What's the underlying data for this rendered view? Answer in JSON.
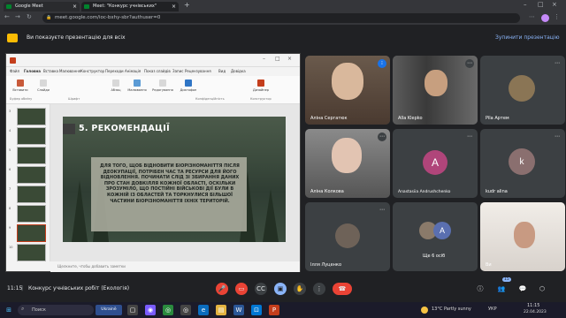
{
  "browser": {
    "tabs": [
      {
        "title": "Google Meet",
        "active": false
      },
      {
        "title": "Meet: \"Конкурс учнівських\"",
        "active": true
      }
    ],
    "url": "meet.google.com/ioc-bxhy-sbr?authuser=0"
  },
  "banner": {
    "message": "Ви показуєте презентацію для всіх",
    "stop_label": "Зупинити презентацію"
  },
  "ppt": {
    "ribbon_tabs": [
      "Файл",
      "Головна",
      "Вставка",
      "Малювання",
      "Конструктор",
      "Переходи",
      "Анімація",
      "Показ слайдів",
      "Запис",
      "Рецензування",
      "Вид",
      "Довідка"
    ],
    "ribbon_buttons": [
      "Вставити",
      "Слайди",
      "Абзац",
      "Малювання",
      "Редагування",
      "Диктофон",
      "Дизайнер"
    ],
    "ribbon_groups": [
      "Буфер обміну",
      "Шрифт",
      "Конфіденційність",
      "Конструктор"
    ],
    "slide_numbers": [
      "3",
      "4",
      "5",
      "6",
      "7",
      "8",
      "9",
      "10"
    ],
    "slide_title": "5. РЕКОМЕНДАЦІЇ",
    "slide_body": "ДЛЯ ТОГО, ЩОБ ВІДНОВИТИ БІОРІЗНОМАНІТТЯ ПІСЛЯ ДЕОКУПАЦІЇ, ПОТРІБЕН ЧАС ТА РЕСУРСИ ДЛЯ ЙОГО ВІДНОВЛЕННЯ. ПОЧИНАТИ СЛІД ЗІ ЗБИРАННЯ ДАНИХ ПРО СТАН ДОВКІЛЛЯ КОЖНОЇ ОБЛАСТІ, ОСКІЛЬКИ ЗРОЗУМІЛО, ЩО ПОСТІЙНІ ВІЙСЬКОВІ ДІЇ БУЛИ В КОЖНІЙ ІЗ ОБЛАСТЕЙ ТА ТОРКНУЛИСЯ БІЛЬШОЇ ЧАСТИНИ БІОРІЗНОМАНІТТЯ ІХНІХ ТЕРИТОРІЙ.",
    "notes_placeholder": "Щелкните, чтобы добавить заметки"
  },
  "participants": [
    {
      "name": "Аліна Сергатюк",
      "type": "video"
    },
    {
      "name": "Alla Klepko",
      "type": "video"
    },
    {
      "name": "Pila Артем",
      "type": "photo"
    },
    {
      "name": "Аліна Колкова",
      "type": "video"
    },
    {
      "name": "Anastasiia Andrushchenko",
      "type": "initial",
      "initial": "A",
      "color": "#b0457a"
    },
    {
      "name": "kudr alina",
      "type": "photo"
    },
    {
      "name": "Ілля Луценко",
      "type": "photo"
    },
    {
      "name": "Ще 6 осіб",
      "type": "group",
      "initial": "A"
    },
    {
      "name": "Ви",
      "type": "video"
    }
  ],
  "meeting": {
    "time": "11:15",
    "title": "Конкурс учнівських робіт (Екологія)",
    "participant_count": "15"
  },
  "taskbar": {
    "search_placeholder": "Поиск",
    "app_label": "Ukrainë",
    "weather": "13°C  Partly sunny",
    "lang": "УКР",
    "clock_time": "11:15",
    "clock_date": "22.04.2023"
  },
  "colors": {
    "accent": "#8ab4f8",
    "danger": "#ea4335",
    "present": "#8ab4f8"
  }
}
